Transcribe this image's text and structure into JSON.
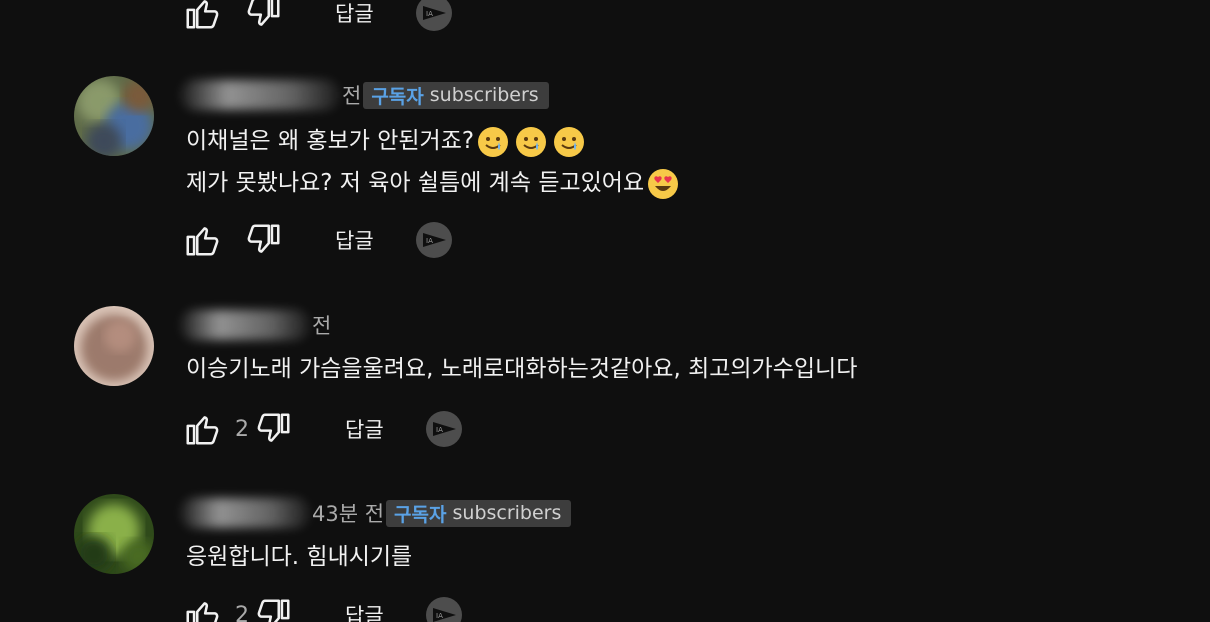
{
  "top_actions": {
    "reply_label": "답글"
  },
  "comments": [
    {
      "time": "전",
      "badge": {
        "ko": "구독자",
        "en": "subscribers"
      },
      "lines": [
        "이채널은 왜 홍보가 안된거죠?",
        "제가 못봤나요? 저 육아 쉴틈에 계속 듣고있어요"
      ],
      "emojis_line1": [
        "tear-smile-emoji",
        "tear-smile-emoji",
        "tear-smile-emoji"
      ],
      "emojis_line2": [
        "heart-eyes-emoji"
      ],
      "like_count": "",
      "reply_label": "답글"
    },
    {
      "time": "전",
      "lines": [
        "이승기노래  가슴을울려요, 노래로대화하는것같아요, 최고의가수입니다"
      ],
      "like_count": "2",
      "reply_label": "답글"
    },
    {
      "time": "43분 전",
      "badge": {
        "ko": "구독자",
        "en": "subscribers"
      },
      "lines": [
        "응원합니다. 힘내시기를"
      ],
      "like_count": "2",
      "reply_label": "답글"
    }
  ],
  "colors": {
    "background": "#0f0f0f",
    "text": "#f1f1f1",
    "secondary_text": "#aaaaaa",
    "badge_bg": "#3d3d3d",
    "badge_accent": "#5aa2e6"
  }
}
